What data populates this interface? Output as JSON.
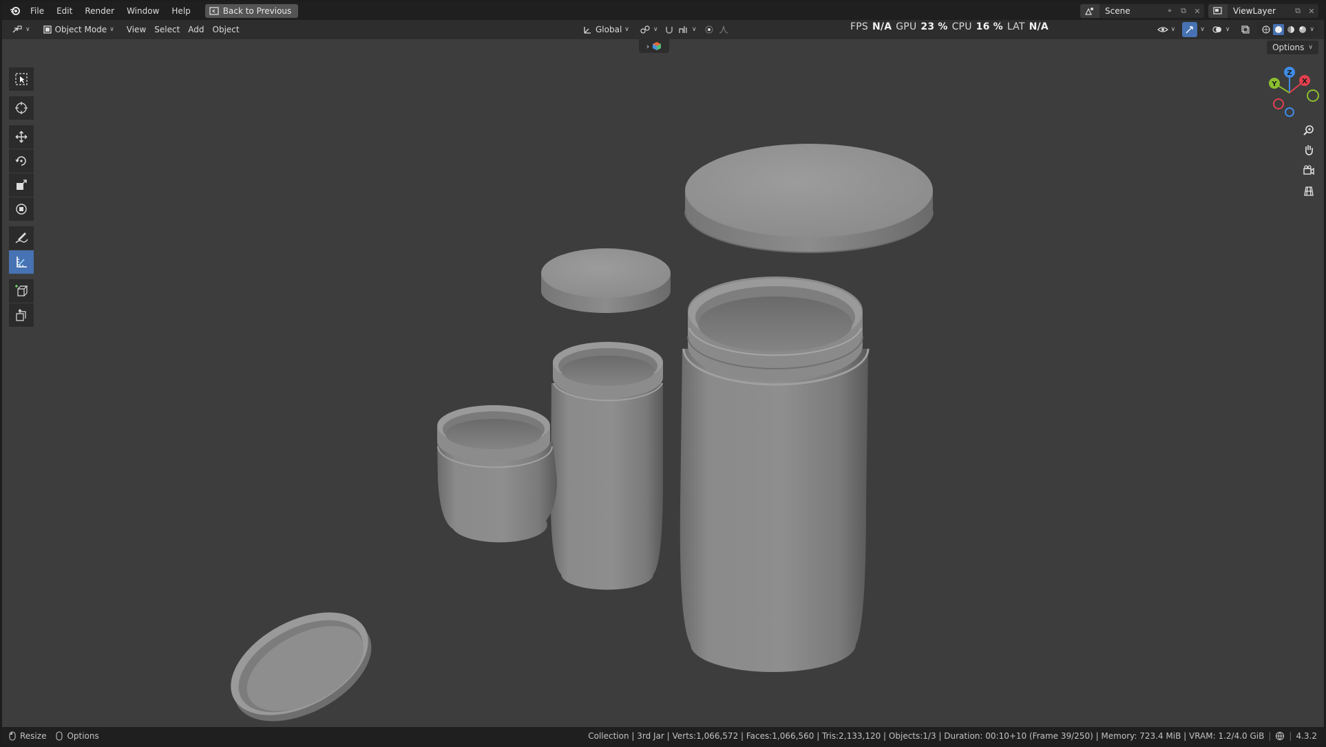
{
  "menubar": {
    "items": [
      "File",
      "Edit",
      "Render",
      "Window",
      "Help"
    ],
    "back_button": "Back to Previous",
    "scene": "Scene",
    "view_layer": "ViewLayer"
  },
  "header": {
    "mode": "Object Mode",
    "menus": [
      "View",
      "Select",
      "Add",
      "Object"
    ],
    "orientation": "Global"
  },
  "stats": {
    "fps_label": "FPS",
    "fps_value": "N/A",
    "gpu_label": "GPU",
    "gpu_value": "23 %",
    "cpu_label": "CPU",
    "cpu_value": "16 %",
    "lat_label": "LAT",
    "lat_value": "N/A"
  },
  "viewport": {
    "options_label": "Options",
    "gizmo_axes": [
      "Z",
      "Y",
      "X"
    ]
  },
  "toolbar": {
    "tools": [
      "select-box-icon",
      "cursor-icon",
      "move-icon",
      "rotate-icon",
      "scale-icon",
      "transform-icon",
      "annotate-icon",
      "measure-icon",
      "add-cube-icon",
      "extrude-icon"
    ],
    "active": "measure-icon"
  },
  "statusbar": {
    "left": [
      "Resize",
      "Options"
    ],
    "info": "Collection | 3rd Jar | Verts:1,066,572 | Faces:1,066,560 | Tris:2,133,120 | Objects:1/3 | Duration: 00:10+10 (Frame 39/250) | Memory: 723.4 MiB | VRAM: 1.2/4.0 GiB",
    "version": "4.3.2"
  },
  "colors": {
    "accent": "#4772b3",
    "axis_x": "#e2404f",
    "axis_y": "#8bbf2f",
    "axis_z": "#3f8ce8"
  }
}
